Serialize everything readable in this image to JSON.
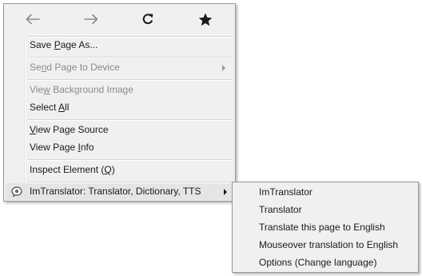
{
  "navbar": {
    "buttons": [
      {
        "name": "back-icon",
        "enabled": false
      },
      {
        "name": "forward-icon",
        "enabled": false
      },
      {
        "name": "reload-icon",
        "enabled": true
      },
      {
        "name": "bookmark-star-icon",
        "enabled": true
      }
    ]
  },
  "menu": {
    "save_page": {
      "pre": "Save ",
      "key": "P",
      "post": "age As..."
    },
    "send_page": {
      "pre": "Se",
      "key": "n",
      "post": "d Page to Device"
    },
    "view_bg": {
      "pre": "Vie",
      "key": "w",
      "post": " Background Image"
    },
    "select_all": {
      "pre": "Select ",
      "key": "A",
      "post": "ll"
    },
    "view_source": {
      "pre": "",
      "key": "V",
      "post": "iew Page Source"
    },
    "view_info": {
      "pre": "View Page ",
      "key": "I",
      "post": "nfo"
    },
    "inspect": {
      "pre": "Inspect Element (",
      "key": "Q",
      "post": ")"
    },
    "imtranslator": {
      "label": "ImTranslator: Translator, Dictionary, TTS"
    }
  },
  "submenu": {
    "items": [
      "ImTranslator",
      "Translator",
      "Translate this page to English",
      "Mouseover translation to English",
      "Options (Change language)"
    ]
  },
  "colors": {
    "menu_bg": "#f0f0f0",
    "border": "#979797",
    "disabled_text": "#8a8a8a",
    "highlight": "#e5e5e5"
  }
}
